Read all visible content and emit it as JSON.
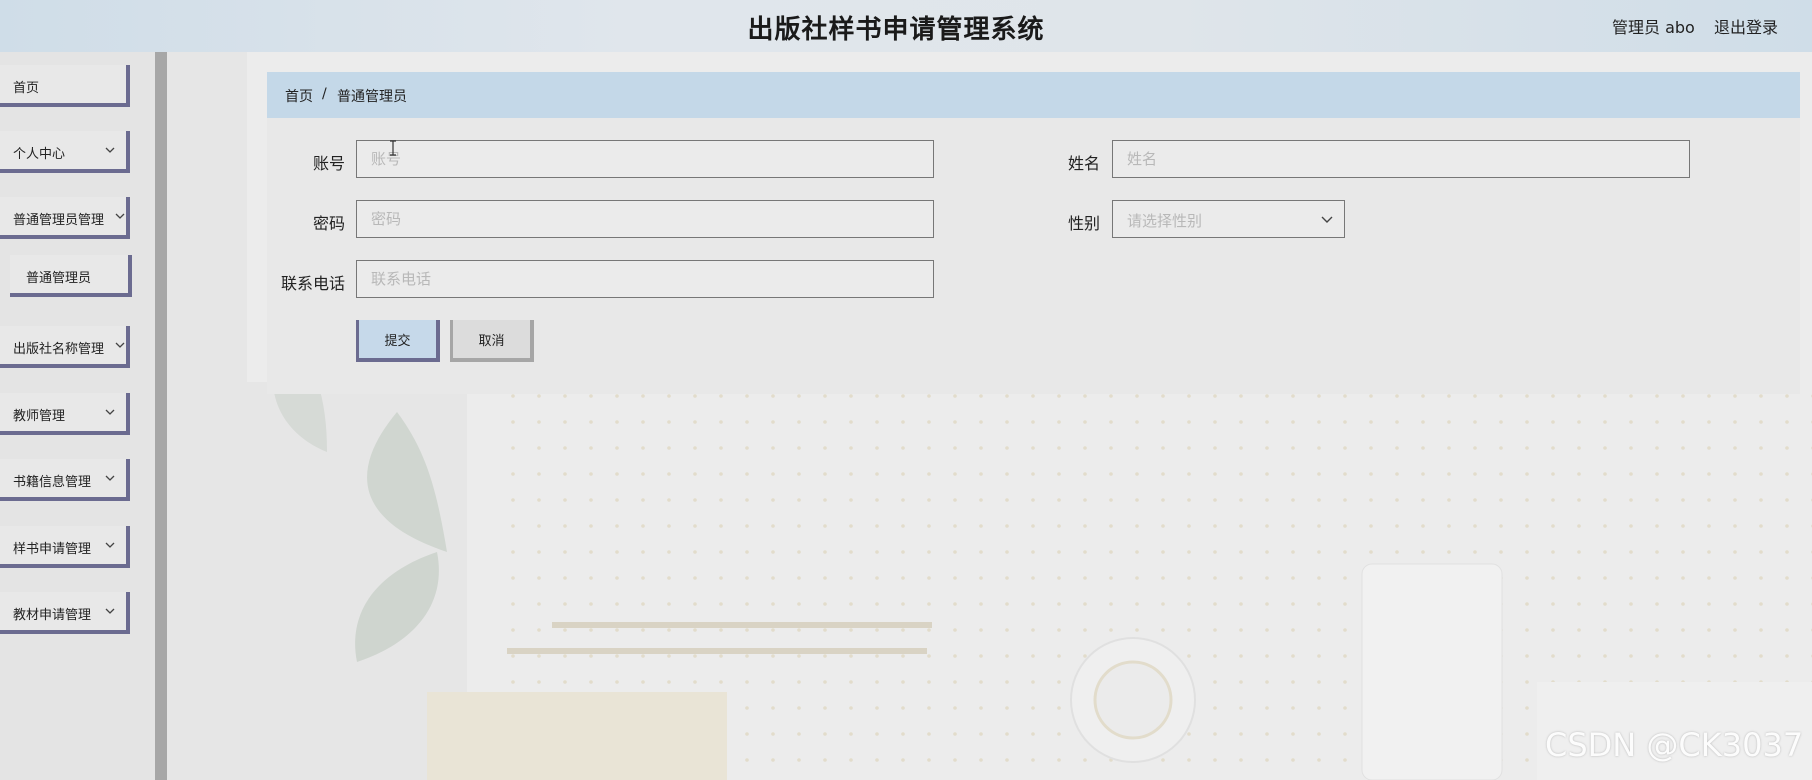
{
  "header": {
    "title": "出版社样书申请管理系统",
    "user_role": "管理员 abo",
    "logout_label": "退出登录"
  },
  "sidebar": {
    "items": [
      {
        "label": "首页",
        "has_chevron": false
      },
      {
        "label": "个人中心",
        "has_chevron": true
      },
      {
        "label": "普通管理员管理",
        "has_chevron": true
      },
      {
        "label": "普通管理员",
        "has_chevron": false,
        "sub": true
      },
      {
        "label": "出版社名称管理",
        "has_chevron": true
      },
      {
        "label": "教师管理",
        "has_chevron": true
      },
      {
        "label": "书籍信息管理",
        "has_chevron": true
      },
      {
        "label": "样书申请管理",
        "has_chevron": true
      },
      {
        "label": "教材申请管理",
        "has_chevron": true
      }
    ]
  },
  "breadcrumb": {
    "home": "首页",
    "separator": "/",
    "current": "普通管理员"
  },
  "form": {
    "account": {
      "label": "账号",
      "value": "",
      "placeholder": "账号"
    },
    "name": {
      "label": "姓名",
      "value": "",
      "placeholder": "姓名"
    },
    "password": {
      "label": "密码",
      "value": "",
      "placeholder": "密码"
    },
    "gender": {
      "label": "性别",
      "selected": "",
      "placeholder": "请选择性别"
    },
    "phone": {
      "label": "联系电话",
      "value": "",
      "placeholder": "联系电话"
    },
    "submit_label": "提交",
    "cancel_label": "取消"
  },
  "watermark": "CSDN @CK3037",
  "colors": {
    "accent_border": "#6b6b90",
    "breadcrumb_bg": "#c4d8e8",
    "submit_bg": "#c6d9ea"
  }
}
